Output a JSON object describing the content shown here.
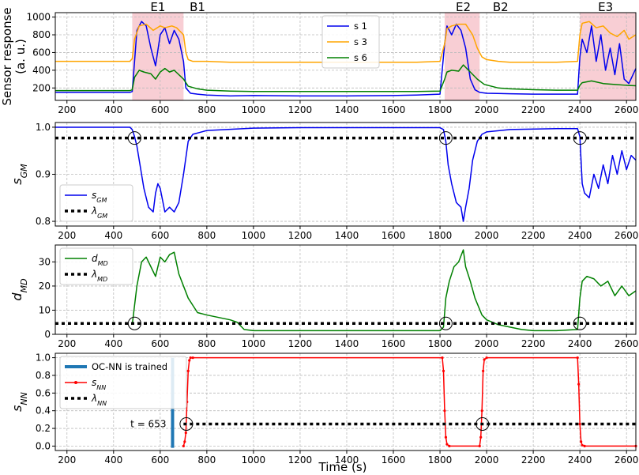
{
  "chart_data": [
    {
      "type": "line",
      "id": "p1",
      "ylabel": "Sensor response\n(a. u.)",
      "xlim": [
        150,
        2640
      ],
      "ylim": [
        60,
        1050
      ],
      "xticks": [
        200,
        400,
        600,
        800,
        1000,
        1200,
        1400,
        1600,
        1800,
        2000,
        2200,
        2400,
        2600
      ],
      "yticks": [
        200,
        400,
        600,
        800,
        1000
      ],
      "grid": true,
      "legend": "top-center",
      "shaded_regions": [
        [
          480,
          700
        ],
        [
          1820,
          1970
        ],
        [
          2400,
          2640
        ]
      ],
      "annotations": [
        {
          "text": "E1",
          "x": 590
        },
        {
          "text": "B1",
          "x": 760
        },
        {
          "text": "E2",
          "x": 1900
        },
        {
          "text": "B2",
          "x": 2060
        },
        {
          "text": "E3",
          "x": 2510
        }
      ],
      "series": [
        {
          "name": "s 1",
          "color": "#0000ee",
          "x": [
            150,
            470,
            480,
            490,
            500,
            520,
            540,
            560,
            580,
            600,
            620,
            640,
            660,
            680,
            700,
            710,
            730,
            760,
            800,
            900,
            1000,
            1200,
            1400,
            1600,
            1700,
            1800,
            1820,
            1830,
            1850,
            1870,
            1890,
            1910,
            1930,
            1950,
            1970,
            2000,
            2100,
            2200,
            2300,
            2390,
            2400,
            2410,
            2430,
            2450,
            2470,
            2490,
            2510,
            2530,
            2550,
            2570,
            2590,
            2610,
            2640
          ],
          "y": [
            150,
            150,
            160,
            500,
            850,
            950,
            900,
            650,
            450,
            800,
            880,
            700,
            850,
            750,
            500,
            200,
            140,
            130,
            120,
            110,
            115,
            110,
            110,
            115,
            120,
            130,
            700,
            900,
            800,
            920,
            850,
            650,
            300,
            180,
            150,
            140,
            135,
            130,
            130,
            130,
            550,
            750,
            600,
            900,
            500,
            800,
            400,
            650,
            350,
            700,
            300,
            250,
            420
          ]
        },
        {
          "name": "s 3",
          "color": "#ffa500",
          "x": [
            150,
            470,
            480,
            490,
            510,
            540,
            570,
            600,
            620,
            650,
            670,
            700,
            710,
            720,
            740,
            800,
            900,
            1000,
            1200,
            1400,
            1600,
            1700,
            1800,
            1820,
            1830,
            1850,
            1880,
            1910,
            1940,
            1960,
            1980,
            2000,
            2050,
            2100,
            2200,
            2300,
            2390,
            2400,
            2410,
            2440,
            2470,
            2500,
            2530,
            2560,
            2590,
            2610,
            2640
          ],
          "y": [
            500,
            500,
            530,
            750,
            900,
            920,
            850,
            900,
            880,
            900,
            880,
            800,
            600,
            520,
            500,
            500,
            490,
            490,
            490,
            490,
            490,
            490,
            500,
            700,
            870,
            900,
            920,
            920,
            800,
            650,
            550,
            520,
            500,
            490,
            490,
            490,
            500,
            800,
            930,
            950,
            880,
            900,
            820,
            780,
            850,
            750,
            800
          ]
        },
        {
          "name": "s 6",
          "color": "#008000",
          "x": [
            150,
            470,
            480,
            490,
            510,
            530,
            560,
            580,
            600,
            620,
            640,
            660,
            680,
            700,
            720,
            760,
            800,
            900,
            1000,
            1200,
            1400,
            1600,
            1700,
            1800,
            1820,
            1830,
            1850,
            1880,
            1900,
            1930,
            1960,
            1990,
            2050,
            2100,
            2200,
            2300,
            2390,
            2400,
            2410,
            2450,
            2500,
            2550,
            2600,
            2640
          ],
          "y": [
            170,
            170,
            180,
            320,
            400,
            380,
            360,
            300,
            380,
            420,
            380,
            400,
            350,
            300,
            220,
            190,
            175,
            165,
            160,
            160,
            160,
            160,
            160,
            165,
            300,
            380,
            400,
            390,
            460,
            380,
            300,
            240,
            200,
            190,
            180,
            175,
            175,
            230,
            260,
            280,
            250,
            240,
            230,
            225
          ]
        }
      ]
    },
    {
      "type": "line",
      "id": "p2",
      "ylabel": "s_GM",
      "xlim": [
        150,
        2640
      ],
      "ylim": [
        0.79,
        1.01
      ],
      "xticks": [
        200,
        400,
        600,
        800,
        1000,
        1200,
        1400,
        1600,
        1800,
        2000,
        2200,
        2400,
        2600
      ],
      "yticks": [
        0.8,
        0.9,
        1.0
      ],
      "ytick_labels": [
        "0.8",
        "0.9",
        "1.0"
      ],
      "grid": true,
      "legend": "lower-left",
      "threshold": 0.977,
      "circles_x": [
        490,
        1825,
        2400
      ],
      "series": [
        {
          "name": "s_GM",
          "color": "#0000ee",
          "x": [
            150,
            470,
            480,
            490,
            500,
            510,
            530,
            550,
            570,
            580,
            590,
            600,
            620,
            640,
            660,
            680,
            700,
            720,
            740,
            800,
            1000,
            1200,
            1400,
            1600,
            1800,
            1815,
            1825,
            1835,
            1850,
            1870,
            1890,
            1900,
            1910,
            1925,
            1940,
            1960,
            1980,
            2000,
            2100,
            2300,
            2390,
            2400,
            2410,
            2420,
            2440,
            2460,
            2480,
            2500,
            2520,
            2540,
            2560,
            2580,
            2600,
            2620,
            2640
          ],
          "y": [
            1.0,
            1.0,
            0.995,
            0.98,
            0.96,
            0.93,
            0.87,
            0.83,
            0.82,
            0.86,
            0.88,
            0.87,
            0.82,
            0.83,
            0.82,
            0.84,
            0.9,
            0.97,
            0.985,
            0.993,
            0.998,
            0.999,
            0.999,
            0.999,
            0.999,
            0.995,
            0.97,
            0.92,
            0.88,
            0.84,
            0.83,
            0.8,
            0.83,
            0.87,
            0.93,
            0.97,
            0.985,
            0.99,
            0.995,
            0.997,
            0.997,
            0.98,
            0.88,
            0.86,
            0.85,
            0.9,
            0.87,
            0.92,
            0.88,
            0.94,
            0.9,
            0.95,
            0.91,
            0.94,
            0.93
          ]
        },
        {
          "name": "λ_GM",
          "color": "#000000",
          "dashed": true,
          "x": [
            150,
            2640
          ],
          "y": [
            0.977,
            0.977
          ]
        }
      ]
    },
    {
      "type": "line",
      "id": "p3",
      "ylabel": "d_MD",
      "xlim": [
        150,
        2640
      ],
      "ylim": [
        0,
        37
      ],
      "xticks": [
        200,
        400,
        600,
        800,
        1000,
        1200,
        1400,
        1600,
        1800,
        2000,
        2200,
        2400,
        2600
      ],
      "yticks": [
        0,
        10,
        20,
        30
      ],
      "grid": true,
      "legend": "top-left",
      "threshold": 4.5,
      "circles_x": [
        490,
        1825,
        2400
      ],
      "series": [
        {
          "name": "d_MD",
          "color": "#008000",
          "x": [
            480,
            490,
            500,
            520,
            540,
            560,
            580,
            600,
            620,
            640,
            660,
            680,
            700,
            720,
            740,
            760,
            800,
            900,
            930,
            960,
            1000,
            1200,
            1400,
            1600,
            1800,
            1815,
            1825,
            1840,
            1860,
            1880,
            1900,
            1910,
            1930,
            1950,
            1980,
            2000,
            2050,
            2100,
            2150,
            2200,
            2300,
            2390,
            2400,
            2410,
            2430,
            2460,
            2490,
            2520,
            2550,
            2580,
            2610,
            2640
          ],
          "y": [
            4,
            12,
            20,
            30,
            32,
            28,
            24,
            32,
            30,
            33,
            34,
            25,
            20,
            15,
            12,
            9,
            8,
            6,
            5,
            2,
            1.5,
            1.5,
            1.5,
            1.5,
            1.5,
            3,
            15,
            22,
            28,
            30,
            35,
            28,
            22,
            15,
            8,
            6,
            4,
            3,
            2,
            1.5,
            1.5,
            2,
            15,
            22,
            24,
            23,
            20,
            22,
            16,
            20,
            16,
            18
          ]
        },
        {
          "name": "λ_MD",
          "color": "#000000",
          "dashed": true,
          "x": [
            150,
            2640
          ],
          "y": [
            4.5,
            4.5
          ]
        }
      ]
    },
    {
      "type": "line",
      "id": "p4",
      "ylabel": "s_NN",
      "xlabel": "Time (s)",
      "xlim": [
        150,
        2640
      ],
      "ylim": [
        -0.05,
        1.05
      ],
      "xticks": [
        200,
        400,
        600,
        800,
        1000,
        1200,
        1400,
        1600,
        1800,
        2000,
        2200,
        2400,
        2600
      ],
      "yticks": [
        0.0,
        0.2,
        0.4,
        0.6,
        0.8,
        1.0
      ],
      "ytick_labels": [
        "0.0",
        "0.2",
        "0.4",
        "0.6",
        "0.8",
        "1.0"
      ],
      "grid": true,
      "legend": "top-left",
      "threshold": 0.25,
      "circles_x": [
        712,
        1982
      ],
      "train_time": 653,
      "train_label": "t = 653",
      "series": [
        {
          "name": "OC-NN is trained",
          "color": "#1f77b4",
          "bar": true,
          "x": [
            653,
            653
          ],
          "y": [
            -0.02,
            1.0
          ]
        },
        {
          "name": "s_NN",
          "color": "#ff0000",
          "marker": true,
          "x": [
            700,
            705,
            710,
            715,
            720,
            725,
            730,
            740,
            1810,
            1815,
            1820,
            1825,
            1830,
            1840,
            1970,
            1975,
            1980,
            1985,
            1990,
            2000,
            2390,
            2395,
            2400,
            2405,
            2410,
            2420,
            2640
          ],
          "y": [
            0.0,
            0.05,
            0.15,
            0.5,
            0.85,
            0.97,
            1.0,
            1.0,
            1.0,
            0.85,
            0.4,
            0.1,
            0.02,
            0.0,
            0.0,
            0.1,
            0.4,
            0.85,
            0.98,
            1.0,
            1.0,
            0.7,
            0.25,
            0.05,
            0.01,
            0.0,
            0.0
          ]
        },
        {
          "name": "λ_NN",
          "color": "#000000",
          "dashed": true,
          "x": [
            700,
            2640
          ],
          "y": [
            0.25,
            0.25
          ]
        }
      ]
    }
  ]
}
